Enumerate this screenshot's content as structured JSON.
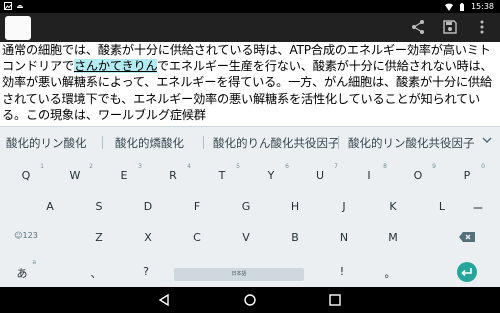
{
  "status_bar": {
    "time": "15:38"
  },
  "editor": {
    "line1": "通常の細胞では、酸素が十分に供給されている時は、ATP合成のエネルギー効率が高いミトコンドリアで",
    "composing": "さんかてきりん",
    "line2": "でエネルギー生産を行ない、酸素が十分に供給されない時は、効率が悪い解糖系によって、エネルギーを得ている。一方、がん細胞は、酸素が十分に供給されている環境下でも、エネルギー効率の悪い解糖系を活性化していることが知られている。この現象は、ワールブルグ症候群"
  },
  "suggestions": [
    "酸化的リン酸化",
    "酸化的燐酸化",
    "酸化的りん酸化共役因子",
    "酸化的リン酸化共役因子"
  ],
  "keys": {
    "row1": [
      {
        "main": "Q",
        "hint": "1"
      },
      {
        "main": "W",
        "hint": "2"
      },
      {
        "main": "E",
        "hint": "3"
      },
      {
        "main": "R",
        "hint": "4"
      },
      {
        "main": "T",
        "hint": "5"
      },
      {
        "main": "Y",
        "hint": "6"
      },
      {
        "main": "U",
        "hint": "7"
      },
      {
        "main": "I",
        "hint": "8"
      },
      {
        "main": "O",
        "hint": "9"
      },
      {
        "main": "P",
        "hint": "0"
      }
    ],
    "row2": [
      {
        "main": "A",
        "hint": ""
      },
      {
        "main": "S",
        "hint": ""
      },
      {
        "main": "D",
        "hint": ""
      },
      {
        "main": "F",
        "hint": ""
      },
      {
        "main": "G",
        "hint": ""
      },
      {
        "main": "H",
        "hint": ""
      },
      {
        "main": "J",
        "hint": ""
      },
      {
        "main": "K",
        "hint": ""
      },
      {
        "main": "L",
        "hint": ""
      },
      {
        "main": "ー",
        "hint": ""
      }
    ],
    "row3": [
      {
        "main": "☺123",
        "hint": ""
      },
      {
        "main": "Z",
        "hint": ""
      },
      {
        "main": "X",
        "hint": ""
      },
      {
        "main": "C",
        "hint": ""
      },
      {
        "main": "V",
        "hint": ""
      },
      {
        "main": "B",
        "hint": ""
      },
      {
        "main": "N",
        "hint": ""
      },
      {
        "main": "M",
        "hint": ""
      },
      {
        "main": "",
        "hint": ""
      }
    ],
    "row4": {
      "lang": "あ",
      "hint": "a",
      "comma": "、",
      "question": "?",
      "space": "日本語",
      "exclaim": "!",
      "period": "。"
    }
  }
}
